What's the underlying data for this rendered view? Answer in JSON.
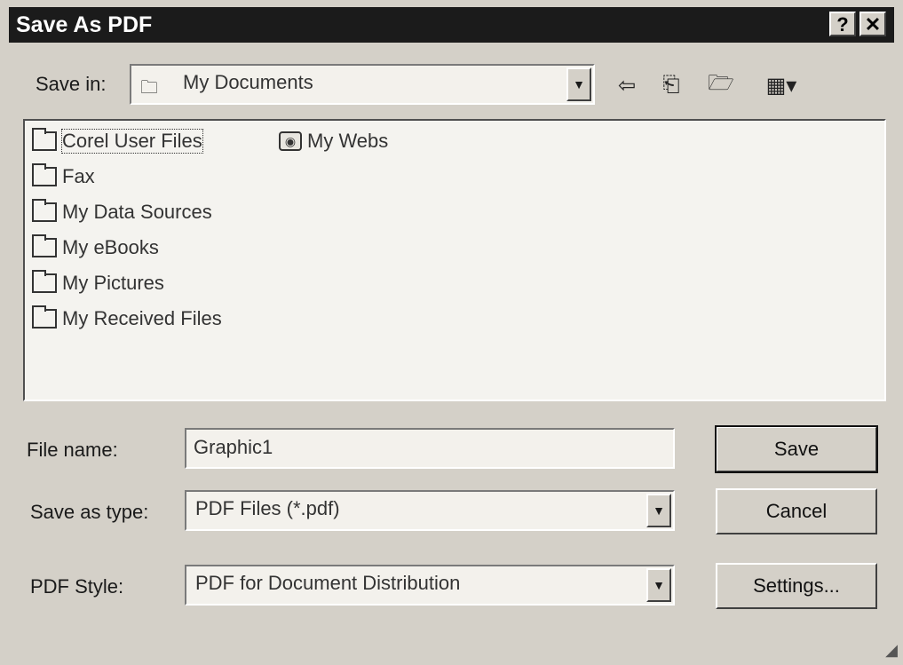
{
  "window": {
    "title": "Save As PDF",
    "help_label": "?",
    "close_label": "✕"
  },
  "save_in": {
    "label": "Save in:",
    "value": "My Documents"
  },
  "toolbar": {
    "back_icon": "back-arrow-icon",
    "up_icon": "up-folder-icon",
    "new_folder_icon": "new-folder-icon",
    "view_icon": "view-menu-icon"
  },
  "files": [
    {
      "name": "Corel User Files",
      "icon": "folder-icon",
      "selected": true
    },
    {
      "name": "Fax",
      "icon": "folder-icon"
    },
    {
      "name": "My Data Sources",
      "icon": "folder-icon"
    },
    {
      "name": "My eBooks",
      "icon": "folder-icon"
    },
    {
      "name": "My Pictures",
      "icon": "folder-icon"
    },
    {
      "name": "My Received Files",
      "icon": "folder-icon"
    },
    {
      "name": "My Webs",
      "icon": "globe-folder-icon"
    }
  ],
  "file_name": {
    "label": "File name:",
    "value": "Graphic1"
  },
  "save_type": {
    "label": "Save as type:",
    "value": "PDF Files (*.pdf)"
  },
  "pdf_style": {
    "label": "PDF Style:",
    "value": "PDF for Document Distribution"
  },
  "buttons": {
    "save": "Save",
    "cancel": "Cancel",
    "settings": "Settings..."
  }
}
